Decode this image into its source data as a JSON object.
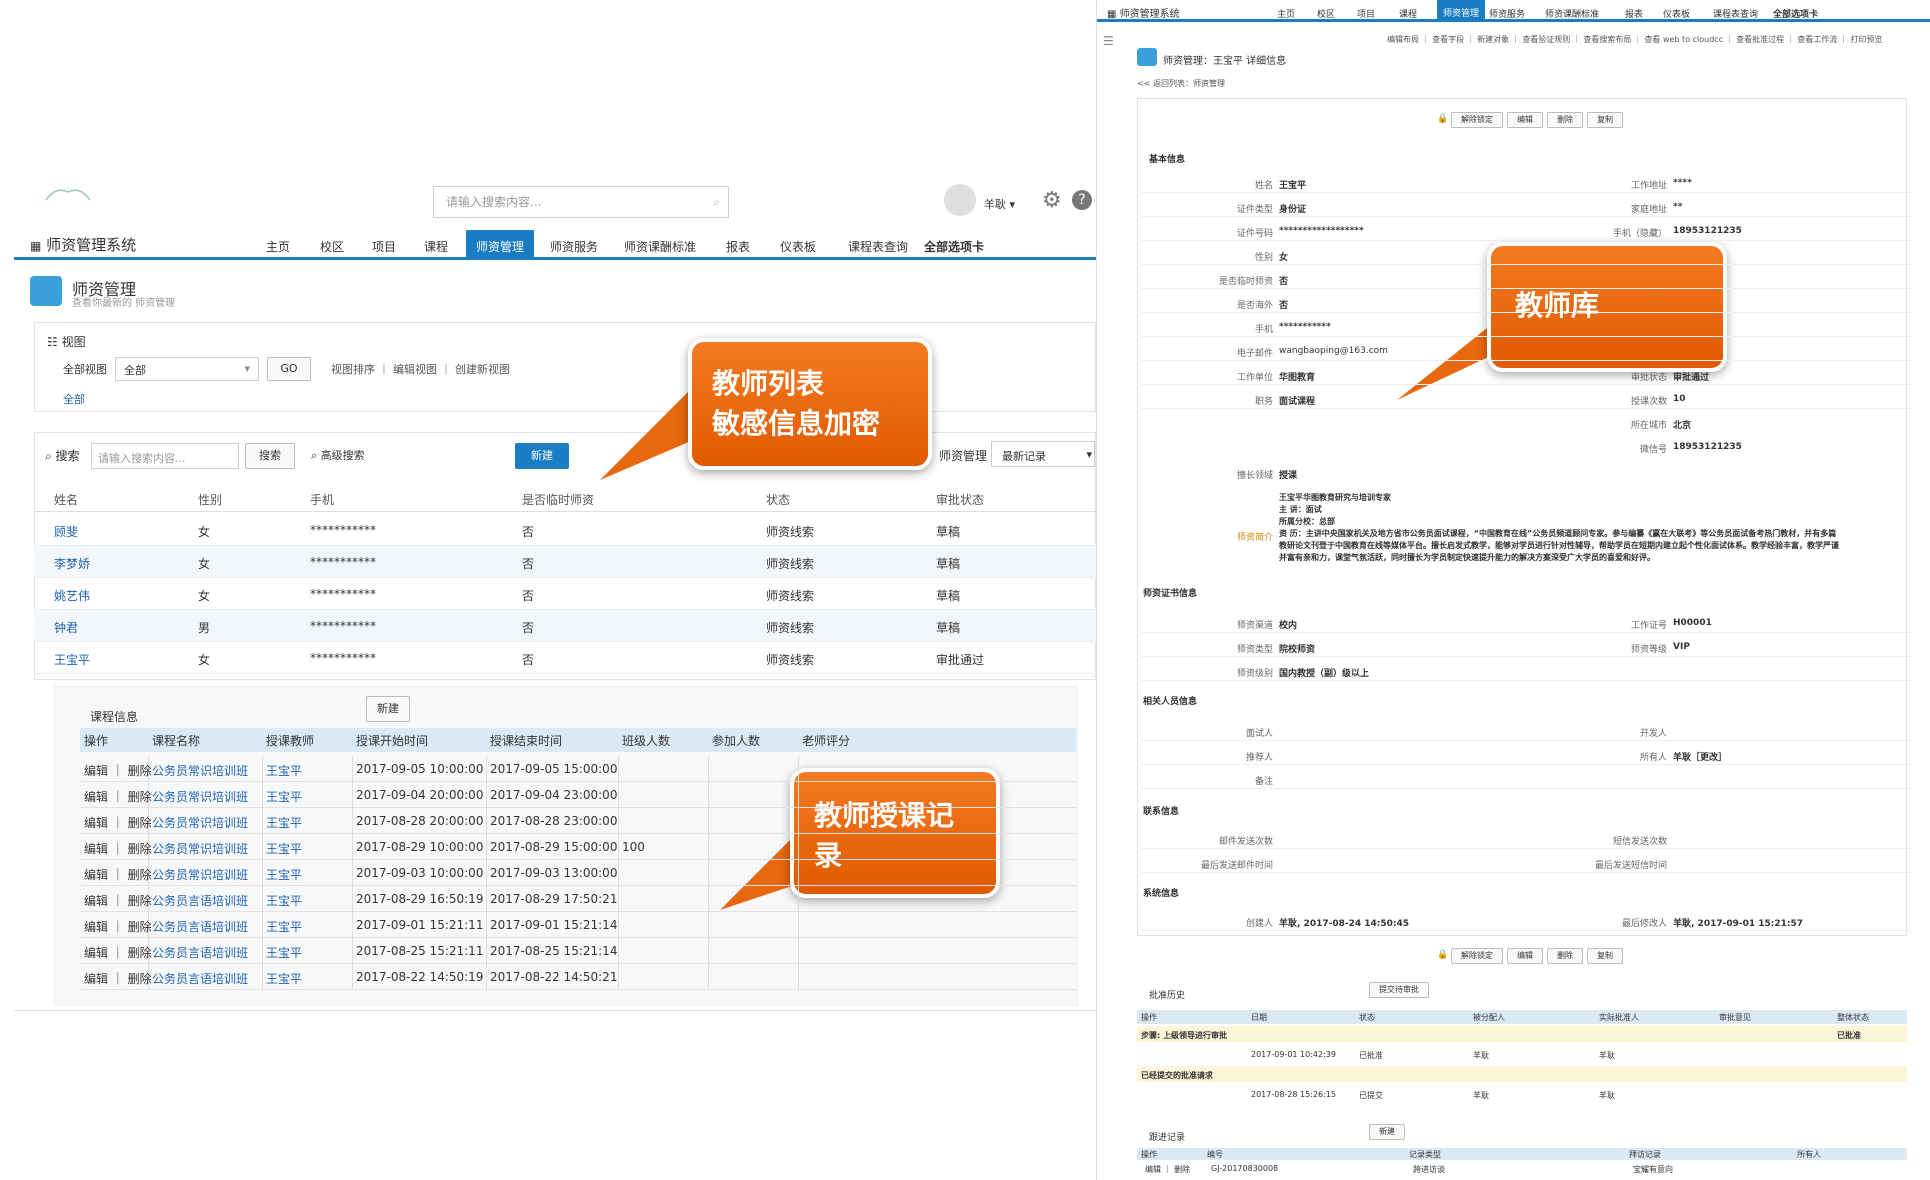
{
  "header": {
    "search_placeholder": "请输入搜索内容...",
    "user": "羊耿",
    "app_title": "师资管理系统"
  },
  "nav": [
    "主页",
    "校区",
    "项目",
    "课程",
    "师资管理",
    "师资服务",
    "师资课酬标准",
    "报表",
    "仪表板",
    "课程表查询",
    "全部选项卡"
  ],
  "page": {
    "title": "师资管理",
    "subtitle": "查看你最新的 师资管理"
  },
  "view": {
    "label": "视图",
    "all_views": "全部视图",
    "select": "全部",
    "go": "GO",
    "links": "视图排序 ｜ 编辑视图 ｜ 创建新视图",
    "all": "全部"
  },
  "search": {
    "label": "搜索",
    "placeholder": "请输入搜索内容...",
    "btn": "搜索",
    "adv": "高级搜索",
    "new": "新建",
    "scope": "师资管理",
    "recent": "最新记录"
  },
  "teacher_table": {
    "headers": [
      "姓名",
      "性别",
      "手机",
      "是否临时师资",
      "状态",
      "审批状态"
    ],
    "rows": [
      [
        "顾斐",
        "女",
        "***********",
        "否",
        "师资线索",
        "草稿"
      ],
      [
        "李梦娇",
        "女",
        "***********",
        "否",
        "师资线索",
        "草稿"
      ],
      [
        "姚艺伟",
        "女",
        "***********",
        "否",
        "师资线索",
        "草稿"
      ],
      [
        "钟君",
        "男",
        "***********",
        "否",
        "师资线索",
        "草稿"
      ],
      [
        "王宝平",
        "女",
        "***********",
        "否",
        "师资线索",
        "审批通过"
      ]
    ]
  },
  "course": {
    "title": "课程信息",
    "new": "新建",
    "headers": [
      "操作",
      "课程名称",
      "授课教师",
      "授课开始时间",
      "授课结束时间",
      "班级人数",
      "参加人数",
      "老师评分"
    ],
    "rows": [
      [
        "编辑 ｜ 删除",
        "公务员常识培训班",
        "王宝平",
        "2017-09-05 10:00:00",
        "2017-09-05 15:00:00",
        ""
      ],
      [
        "编辑 ｜ 删除",
        "公务员常识培训班",
        "王宝平",
        "2017-09-04 20:00:00",
        "2017-09-04 23:00:00",
        ""
      ],
      [
        "编辑 ｜ 删除",
        "公务员常识培训班",
        "王宝平",
        "2017-08-28 20:00:00",
        "2017-08-28 23:00:00",
        ""
      ],
      [
        "编辑 ｜ 删除",
        "公务员常识培训班",
        "王宝平",
        "2017-08-29 10:00:00",
        "2017-08-29 15:00:00",
        "100"
      ],
      [
        "编辑 ｜ 删除",
        "公务员常识培训班",
        "王宝平",
        "2017-09-03 10:00:00",
        "2017-09-03 13:00:00",
        ""
      ],
      [
        "编辑 ｜ 删除",
        "公务员言语培训班",
        "王宝平",
        "2017-08-29 16:50:19",
        "2017-08-29 17:50:21",
        ""
      ],
      [
        "编辑 ｜ 删除",
        "公务员言语培训班",
        "王宝平",
        "2017-09-01 15:21:11",
        "2017-09-01 15:21:14",
        ""
      ],
      [
        "编辑 ｜ 删除",
        "公务员言语培训班",
        "王宝平",
        "2017-08-25 15:21:11",
        "2017-08-25 15:21:14",
        ""
      ],
      [
        "编辑 ｜ 删除",
        "公务员言语培训班",
        "王宝平",
        "2017-08-22 14:50:19",
        "2017-08-22 14:50:21",
        ""
      ]
    ]
  },
  "callouts": {
    "list": [
      "教师列表",
      "敏感信息加密"
    ],
    "course": [
      "教师授课记",
      "录"
    ],
    "lib": "教师库"
  },
  "detail": {
    "app": "师资管理系统",
    "nav": [
      "主页",
      "校区",
      "项目",
      "课程",
      "师资管理",
      "师资服务",
      "师资课酬标准",
      "报表",
      "仪表板",
      "课程表查询",
      "全部选项卡"
    ],
    "links": "编辑布局 ｜ 查看字段 ｜ 新建对象 ｜ 查看验证规则 ｜ 查看搜索布局 ｜ 查看 web to cloudcc ｜ 查看批准过程 ｜ 查看工作流 ｜ 打印预览",
    "title": "师资管理：王宝平 详细信息",
    "back": "<< 返回列表：师资管理",
    "buttons": [
      "解除锁定",
      "编辑",
      "删除",
      "复制"
    ],
    "section_basic": "基本信息",
    "left_fields": [
      [
        "姓名",
        "王宝平"
      ],
      [
        "证件类型",
        "身份证"
      ],
      [
        "证件号码",
        "******************"
      ],
      [
        "性别",
        "女"
      ],
      [
        "是否临时师资",
        "否"
      ],
      [
        "是否海外",
        "否"
      ],
      [
        "手机",
        "***********"
      ],
      [
        "电子邮件",
        "wangbaoping@163.com"
      ],
      [
        "工作单位",
        "华图教育"
      ],
      [
        "职务",
        "面试课程"
      ]
    ],
    "right_fields": [
      [
        "工作地址",
        "****"
      ],
      [
        "家庭地址",
        "**"
      ],
      [
        "手机（隐藏）",
        "18953121235"
      ],
      [
        "审批状态",
        "审批通过"
      ],
      [
        "授课次数",
        "10"
      ],
      [
        "所在城市",
        "北京"
      ],
      [
        "微信号",
        "18953121235"
      ]
    ],
    "specialty": [
      "擅长领域",
      "授课"
    ],
    "intro_label": "师资简介",
    "intro": [
      "王宝平华图教育研究与培训专家",
      "主 讲：面试",
      "所属分校：总部",
      "资 历：主讲中央国家机关及地方省市公务员面试课程，“中国教育在线”公务员频道顾问专家。参与编纂《赢在大联考》等公务员面试备考热门教材，并有多篇",
      "教研论文刊登于中国教育在线等媒体平台。擅长启发式教学，能够对学员进行针对性辅导，帮助学员在短期内建立起个性化面试体系。教学经验丰富，教学严谨",
      "并富有亲和力，课堂气氛活跃，同时擅长为学员制定快速提升能力的解决方案深受广大学员的喜爱和好评。"
    ],
    "section_cert": "师资证书信息",
    "cert": [
      [
        "师资渠道",
        "校内",
        "工作证号",
        "H00001"
      ],
      [
        "师资类型",
        "院校师资",
        "师资等级",
        "VIP"
      ],
      [
        "师资级别",
        "国内教授（副）级以上",
        "",
        ""
      ]
    ],
    "section_rel": "相关人员信息",
    "rel": [
      [
        "面试人",
        "",
        "开发人",
        ""
      ],
      [
        "推荐人",
        "",
        "所有人",
        "羊耿［更改］"
      ],
      [
        "备注",
        "",
        "",
        ""
      ]
    ],
    "section_contact": "联系信息",
    "contact": [
      [
        "邮件发送次数",
        "",
        "短信发送次数",
        ""
      ],
      [
        "最后发送邮件时间",
        "",
        "最后发送短信时间",
        ""
      ]
    ],
    "section_sys": "系统信息",
    "sys": [
      [
        "创建人",
        "羊耿, 2017-08-24 14:50:45",
        "最后修改人",
        "羊耿, 2017-09-01 15:21:57"
      ]
    ],
    "approval": {
      "title": "批准历史",
      "btn": "提交待审批",
      "headers": [
        "操作",
        "日期",
        "状态",
        "被分配人",
        "实际批准人",
        "审批意见",
        "整体状态"
      ],
      "step1": "步骤: 上级领导进行审批",
      "status1": "已批准",
      "r1": [
        "2017-09-01 10:42:39",
        "已批准",
        "羊耿",
        "羊耿"
      ],
      "step2": "已经提交的批准请求",
      "r2": [
        "2017-08-28 15:26:15",
        "已提交",
        "羊耿",
        "羊耿"
      ]
    },
    "follow": {
      "title": "跟进记录",
      "btn": "新建",
      "headers": [
        "操作",
        "编号",
        "记录类型",
        "拜访记录",
        "所有人"
      ],
      "r": [
        "编辑 ｜ 删除",
        "GJ-20170830008",
        "跨进访谈",
        "宝耀有意向",
        ""
      ]
    }
  }
}
